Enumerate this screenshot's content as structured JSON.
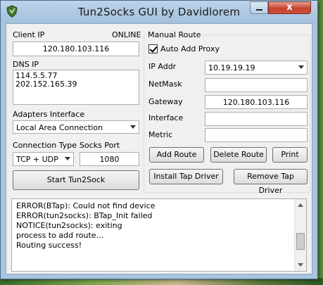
{
  "window": {
    "title": "Tun2Socks GUI by Davidlorem",
    "close_glyph": "x"
  },
  "left": {
    "client_ip_label": "Client IP",
    "status": "ONLINE",
    "client_ip_value": "120.180.103.116",
    "dns_ip_label": "DNS IP",
    "dns_lines": [
      "114.5.5.77",
      "202.152.165.39"
    ],
    "adapters_label": "Adapters Interface",
    "adapter_value": "Local Area Connection",
    "connection_type_label": "Connection Type",
    "connection_type_value": "TCP + UDP",
    "socks_port_label": "Socks Port",
    "socks_port_value": "1080",
    "start_button": "Start Tun2Sock"
  },
  "route": {
    "group_title": "Manual Route",
    "auto_add_proxy_label": "Auto Add Proxy",
    "auto_add_proxy_checked": true,
    "ip_addr_label": "IP Addr",
    "ip_addr_value": "10.19.19.19",
    "netmask_label": "NetMask",
    "netmask_value": "",
    "gateway_label": "Gateway",
    "gateway_value": "120.180.103.116",
    "interface_label": "Interface",
    "interface_value": "",
    "metric_label": "Metric",
    "metric_value": "",
    "add_route_button": "Add Route",
    "delete_route_button": "Delete Route",
    "print_button": "Print",
    "install_tap_button": "Install Tap Driver",
    "remove_tap_button": "Remove Tap Driver"
  },
  "log": {
    "lines": [
      "ERROR(BTap): Could not find device",
      "ERROR(tun2socks): BTap_Init failed",
      "NOTICE(tun2socks): exiting",
      "process to add route...",
      "Routing success!"
    ]
  },
  "icons": {
    "app": "shield-icon",
    "minimize": "minimize-icon",
    "close": "close-icon",
    "scroll_up": "scroll-up-icon",
    "scroll_down": "scroll-down-icon"
  }
}
